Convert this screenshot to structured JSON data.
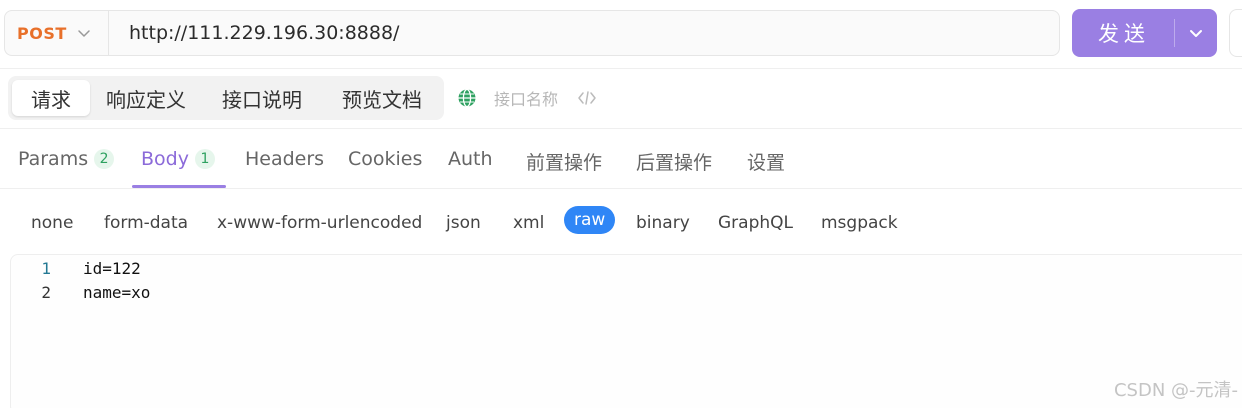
{
  "request": {
    "method": "POST",
    "url": "http://111.229.196.30:8888/",
    "send_label": "发送"
  },
  "segments": [
    {
      "label": "请求",
      "active": true
    },
    {
      "label": "响应定义",
      "active": false
    },
    {
      "label": "接口说明",
      "active": false
    },
    {
      "label": "预览文档",
      "active": false
    }
  ],
  "api_name_placeholder": "接口名称",
  "tabs": [
    {
      "label": "Params",
      "badge": "2",
      "active": false
    },
    {
      "label": "Body",
      "badge": "1",
      "active": true
    },
    {
      "label": "Headers",
      "active": false
    },
    {
      "label": "Cookies",
      "active": false
    },
    {
      "label": "Auth",
      "active": false
    },
    {
      "label": "前置操作",
      "active": false
    },
    {
      "label": "后置操作",
      "active": false
    },
    {
      "label": "设置",
      "active": false
    }
  ],
  "body_types": [
    {
      "label": "none"
    },
    {
      "label": "form-data"
    },
    {
      "label": "x-www-form-urlencoded"
    },
    {
      "label": "json"
    },
    {
      "label": "xml"
    },
    {
      "label": "raw",
      "active": true
    },
    {
      "label": "binary"
    },
    {
      "label": "GraphQL"
    },
    {
      "label": "msgpack"
    }
  ],
  "editor": {
    "lines": [
      {
        "num": "1",
        "text": "id=122"
      },
      {
        "num": "2",
        "text": "name=xo"
      }
    ]
  },
  "watermark": "CSDN @-元清-",
  "colors": {
    "method": "#e8702a",
    "accent": "#9a7fe3",
    "raw_active": "#2f86f6",
    "badge_green": "#2ea160"
  },
  "icons": {
    "method_dropdown": "chevron-down-icon",
    "send_dropdown": "chevron-down-icon",
    "globe": "globe-icon",
    "code": "code-icon"
  }
}
